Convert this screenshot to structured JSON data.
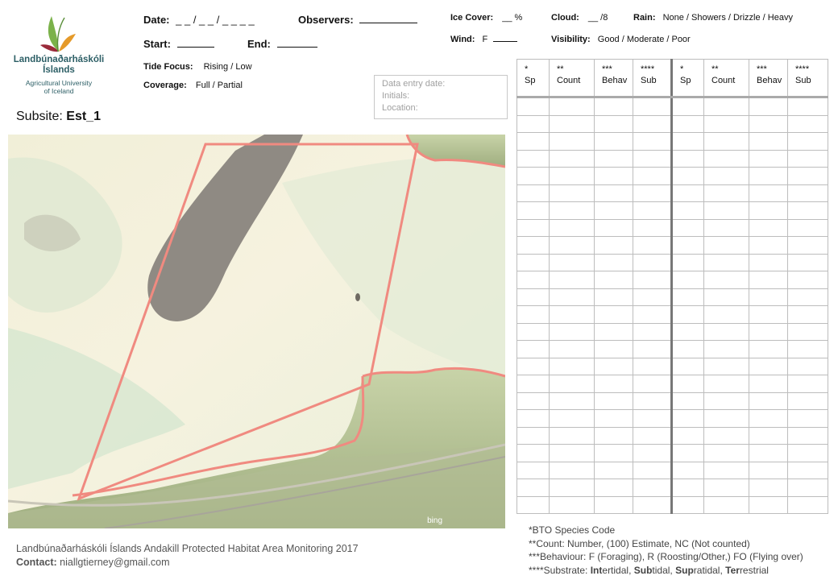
{
  "logo": {
    "line1": "Landbúnaðarháskóli",
    "line2": "Íslands",
    "line3": "Agricultural University",
    "line4": "of Iceland"
  },
  "header": {
    "date_label": "Date:",
    "date_blank": "_ _  / _ _  / _ _ _ _",
    "observers_label": "Observers:",
    "start_label": "Start:",
    "end_label": "End:",
    "tide_label": "Tide Focus:",
    "tide_options": "Rising  /  Low",
    "coverage_label": "Coverage:",
    "coverage_options": "Full / Partial",
    "ice_label": "Ice Cover:",
    "ice_blank": "__  %",
    "cloud_label": "Cloud:",
    "cloud_blank": "__  /8",
    "rain_label": "Rain:",
    "rain_options": "None / Showers / Drizzle / Heavy",
    "wind_label": "Wind:",
    "wind_blank": "F",
    "visibility_label": "Visibility:",
    "visibility_options": "Good / Moderate / Poor"
  },
  "entry_box": {
    "date": "Data entry date:",
    "initials": "Initials:",
    "location": "Location:"
  },
  "subsite": {
    "label": "Subsite: ",
    "value": "Est_1"
  },
  "map": {
    "attribution": "bing"
  },
  "tally": {
    "headers": [
      {
        "mark": "*",
        "label": "Sp"
      },
      {
        "mark": "**",
        "label": "Count"
      },
      {
        "mark": "***",
        "label": "Behav"
      },
      {
        "mark": "****",
        "label": "Sub"
      },
      {
        "mark": "*",
        "label": "Sp"
      },
      {
        "mark": "**",
        "label": "Count"
      },
      {
        "mark": "***",
        "label": "Behav"
      },
      {
        "mark": "****",
        "label": "Sub"
      }
    ],
    "rows": 24
  },
  "legend": {
    "l1": "*BTO Species Code",
    "l2": "**Count: Number, (100) Estimate, NC (Not counted)",
    "l3": "***Behaviour: F (Foraging), R (Roosting/Other,) FO (Flying over)",
    "l4_prefix": "****Substrate: ",
    "s1b": "Int",
    "s1": "ertidal, ",
    "s2b": "Sub",
    "s2": "tidal, ",
    "s3b": "Sup",
    "s3": "ratidal, ",
    "s4b": "Ter",
    "s4": "restrial"
  },
  "footer": {
    "line1": "Landbúnaðarháskóli Íslands Andakill Protected Habitat Area Monitoring 2017",
    "contact_label": "Contact:",
    "contact_value": " niallgtierney@gmail.com"
  },
  "colors": {
    "boundary": "#f08a80",
    "accent": "#2d5f66"
  }
}
